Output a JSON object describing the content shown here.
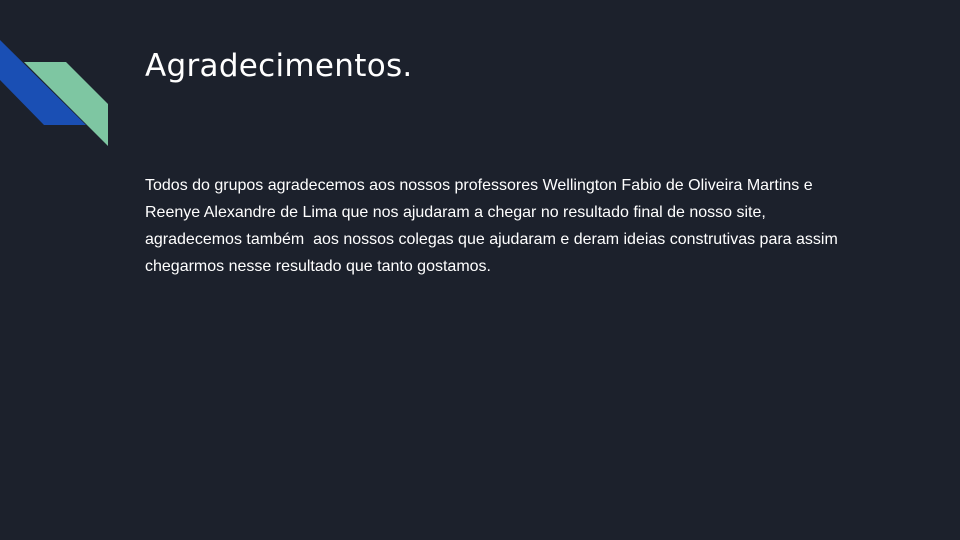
{
  "slide": {
    "title": "Agradecimentos.",
    "body_lines": [
      "Todos do grupos agradecemos aos nossos professores Wellington Fabio de Oliveira Martins e",
      "Reenye Alexandre de Lima que nos ajudaram a chegar no resultado final de nosso site,",
      "agradecemos também  aos nossos colegas que ajudaram e deram ideias construtivas para assim",
      "chegarmos nesse resultado que tanto gostamos."
    ]
  },
  "colors": {
    "background": "#1c212c",
    "accent_blue": "#1a4fb4",
    "accent_green": "#7ec6a2",
    "text": "#ffffff"
  }
}
